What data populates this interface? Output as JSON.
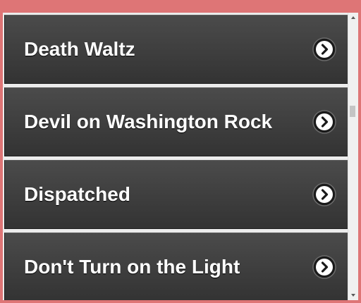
{
  "list": {
    "items": [
      {
        "label": "Death Waltz",
        "icon": "chevron-right-circle-icon"
      },
      {
        "label": "Devil on Washington Rock",
        "icon": "chevron-right-circle-icon"
      },
      {
        "label": "Dispatched",
        "icon": "chevron-right-circle-icon"
      },
      {
        "label": "Don't Turn on the Light",
        "icon": "chevron-right-circle-icon"
      }
    ]
  },
  "colors": {
    "frame": "#de7576",
    "row_top": "#4b4b4b",
    "row_bottom": "#333333",
    "text": "#ffffff"
  }
}
